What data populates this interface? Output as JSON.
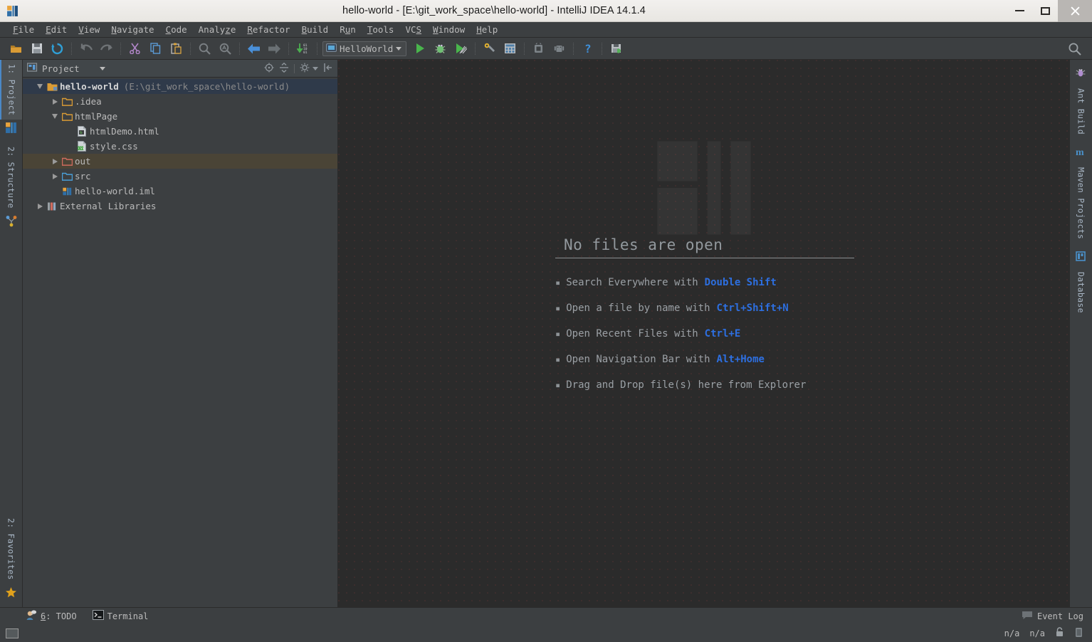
{
  "window": {
    "title": "hello-world - [E:\\git_work_space\\hello-world] - IntelliJ IDEA 14.1.4",
    "logo_icon": "intellij-idea-logo-icon",
    "controls": {
      "minimize_icon": "minimize-icon",
      "maximize_icon": "maximize-icon",
      "close_icon": "close-icon"
    }
  },
  "menubar": {
    "items": [
      {
        "label": "File",
        "mnemonic": "F"
      },
      {
        "label": "Edit",
        "mnemonic": "E"
      },
      {
        "label": "View",
        "mnemonic": "V"
      },
      {
        "label": "Navigate",
        "mnemonic": "N"
      },
      {
        "label": "Code",
        "mnemonic": "C"
      },
      {
        "label": "Analyze",
        "mnemonic": "z"
      },
      {
        "label": "Refactor",
        "mnemonic": "R"
      },
      {
        "label": "Build",
        "mnemonic": "B"
      },
      {
        "label": "Run",
        "mnemonic": "u"
      },
      {
        "label": "Tools",
        "mnemonic": "T"
      },
      {
        "label": "VCS",
        "mnemonic": "S"
      },
      {
        "label": "Window",
        "mnemonic": "W"
      },
      {
        "label": "Help",
        "mnemonic": "H"
      }
    ]
  },
  "toolbar": {
    "buttons": [
      {
        "name": "open-project-icon"
      },
      {
        "name": "save-all-icon"
      },
      {
        "name": "synchronize-icon"
      },
      {
        "name": "undo-icon"
      },
      {
        "name": "redo-icon"
      },
      {
        "name": "cut-icon"
      },
      {
        "name": "copy-icon"
      },
      {
        "name": "paste-icon"
      },
      {
        "name": "find-icon"
      },
      {
        "name": "replace-icon"
      },
      {
        "name": "back-icon"
      },
      {
        "name": "forward-icon"
      },
      {
        "name": "compile-icon"
      }
    ],
    "run_config": {
      "label": "HelloWorld",
      "icon": "run-configuration-icon",
      "dropdown_icon": "chevron-down-icon"
    },
    "run_buttons": [
      {
        "name": "run-icon"
      },
      {
        "name": "debug-icon"
      },
      {
        "name": "run-with-coverage-icon"
      },
      {
        "name": "project-structure-icon"
      },
      {
        "name": "settings-icon"
      },
      {
        "name": "avd-manager-icon"
      },
      {
        "name": "sdk-manager-icon"
      },
      {
        "name": "help-icon"
      },
      {
        "name": "android-monitor-icon"
      }
    ],
    "search_icon": "search-everywhere-icon"
  },
  "left_stripe": {
    "top_items": [
      {
        "label": "1: Project",
        "icon": "project-icon",
        "active": true
      },
      {
        "label": "2: Structure",
        "icon": "structure-icon",
        "active": false
      }
    ],
    "bottom_items": [
      {
        "label": "2: Favorites",
        "icon": "favorites-star-icon",
        "active": false
      }
    ]
  },
  "right_stripe": {
    "items": [
      {
        "label": "Ant Build",
        "icon": "ant-build-icon"
      },
      {
        "label": "Maven Projects",
        "icon": "maven-icon"
      },
      {
        "label": "Database",
        "icon": "database-icon"
      }
    ]
  },
  "project_panel": {
    "header": {
      "title": "Project",
      "view_icon": "project-view-icon",
      "dropdown_icon": "chevron-down-icon",
      "tools": [
        {
          "name": "scroll-from-source-icon"
        },
        {
          "name": "collapse-all-icon"
        },
        {
          "name": "settings-gear-icon"
        },
        {
          "name": "hide-panel-icon"
        }
      ]
    },
    "tree": [
      {
        "label": "hello-world",
        "detail": "(E:\\git_work_space\\hello-world)",
        "indent": 0,
        "expander": "down",
        "icon": "project-module-icon",
        "state": "selected",
        "bold": true
      },
      {
        "label": ".idea",
        "detail": "",
        "indent": 1,
        "expander": "right",
        "icon": "folder-icon",
        "state": ""
      },
      {
        "label": "htmlPage",
        "detail": "",
        "indent": 1,
        "expander": "down",
        "icon": "folder-icon",
        "state": ""
      },
      {
        "label": "htmlDemo.html",
        "detail": "",
        "indent": 2,
        "expander": "none",
        "icon": "html-file-icon",
        "state": ""
      },
      {
        "label": "style.css",
        "detail": "",
        "indent": 2,
        "expander": "none",
        "icon": "css-file-icon",
        "state": ""
      },
      {
        "label": "out",
        "detail": "",
        "indent": 1,
        "expander": "right",
        "icon": "excluded-folder-icon",
        "state": "highlighted"
      },
      {
        "label": "src",
        "detail": "",
        "indent": 1,
        "expander": "right",
        "icon": "source-folder-icon",
        "state": ""
      },
      {
        "label": "hello-world.iml",
        "detail": "",
        "indent": 1,
        "expander": "none",
        "icon": "iml-file-icon",
        "state": ""
      },
      {
        "label": "External Libraries",
        "detail": "",
        "indent": 0,
        "expander": "right",
        "icon": "libraries-icon",
        "state": ""
      }
    ]
  },
  "editor": {
    "watermark_icon": "intellij-idea-watermark-logo",
    "empty_title": "No files are open",
    "tips": [
      {
        "text": "Search Everywhere with",
        "key": "Double Shift"
      },
      {
        "text": "Open a file by name with",
        "key": "Ctrl+Shift+N"
      },
      {
        "text": "Open Recent Files with",
        "key": "Ctrl+E"
      },
      {
        "text": "Open Navigation Bar with",
        "key": "Alt+Home"
      },
      {
        "text": "Drag and Drop file(s) here from Explorer",
        "key": ""
      }
    ]
  },
  "bottom_bar": {
    "items": [
      {
        "label": "6: TODO",
        "mnemonic": "6",
        "icon": "todo-icon"
      },
      {
        "label": "Terminal",
        "mnemonic": "",
        "icon": "terminal-icon"
      }
    ],
    "event_log": {
      "label": "Event Log",
      "icon": "event-log-icon"
    }
  },
  "status_bar": {
    "position_box_icon": "status-box-icon",
    "values": [
      "n/a",
      "n/a"
    ],
    "lock_icon": "lock-icon",
    "memory_icon": "memory-indicator-icon"
  },
  "colors": {
    "panel_bg": "#3c3f41",
    "editor_bg": "#2b2b2b",
    "accent_blue": "#2d6fe0",
    "selection_blue": "#2f3a4a",
    "highlight_brown": "#4a4436",
    "text": "#bbbbbb"
  }
}
